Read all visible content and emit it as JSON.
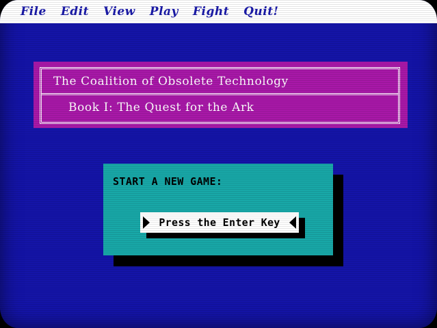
{
  "menu": {
    "items": [
      {
        "label": "File"
      },
      {
        "label": "Edit"
      },
      {
        "label": "View"
      },
      {
        "label": "Play"
      },
      {
        "label": "Fight"
      },
      {
        "label": "Quit!"
      }
    ]
  },
  "title_panel": {
    "line1": "The Coalition of Obsolete Technology",
    "line2": "Book I: The Quest for the Ark"
  },
  "dialog": {
    "label": "START A NEW GAME:",
    "button_label": "Press the Enter Key"
  },
  "colors": {
    "background": "#1414a8",
    "menubar": "#ffffff",
    "menu_text": "#1a1aa8",
    "title_panel": "#a818a8",
    "dialog": "#18a8a8",
    "button": "#ffffff"
  },
  "icons": {
    "left_arrow": "right-pointing-triangle-icon",
    "right_arrow": "left-pointing-triangle-icon"
  }
}
